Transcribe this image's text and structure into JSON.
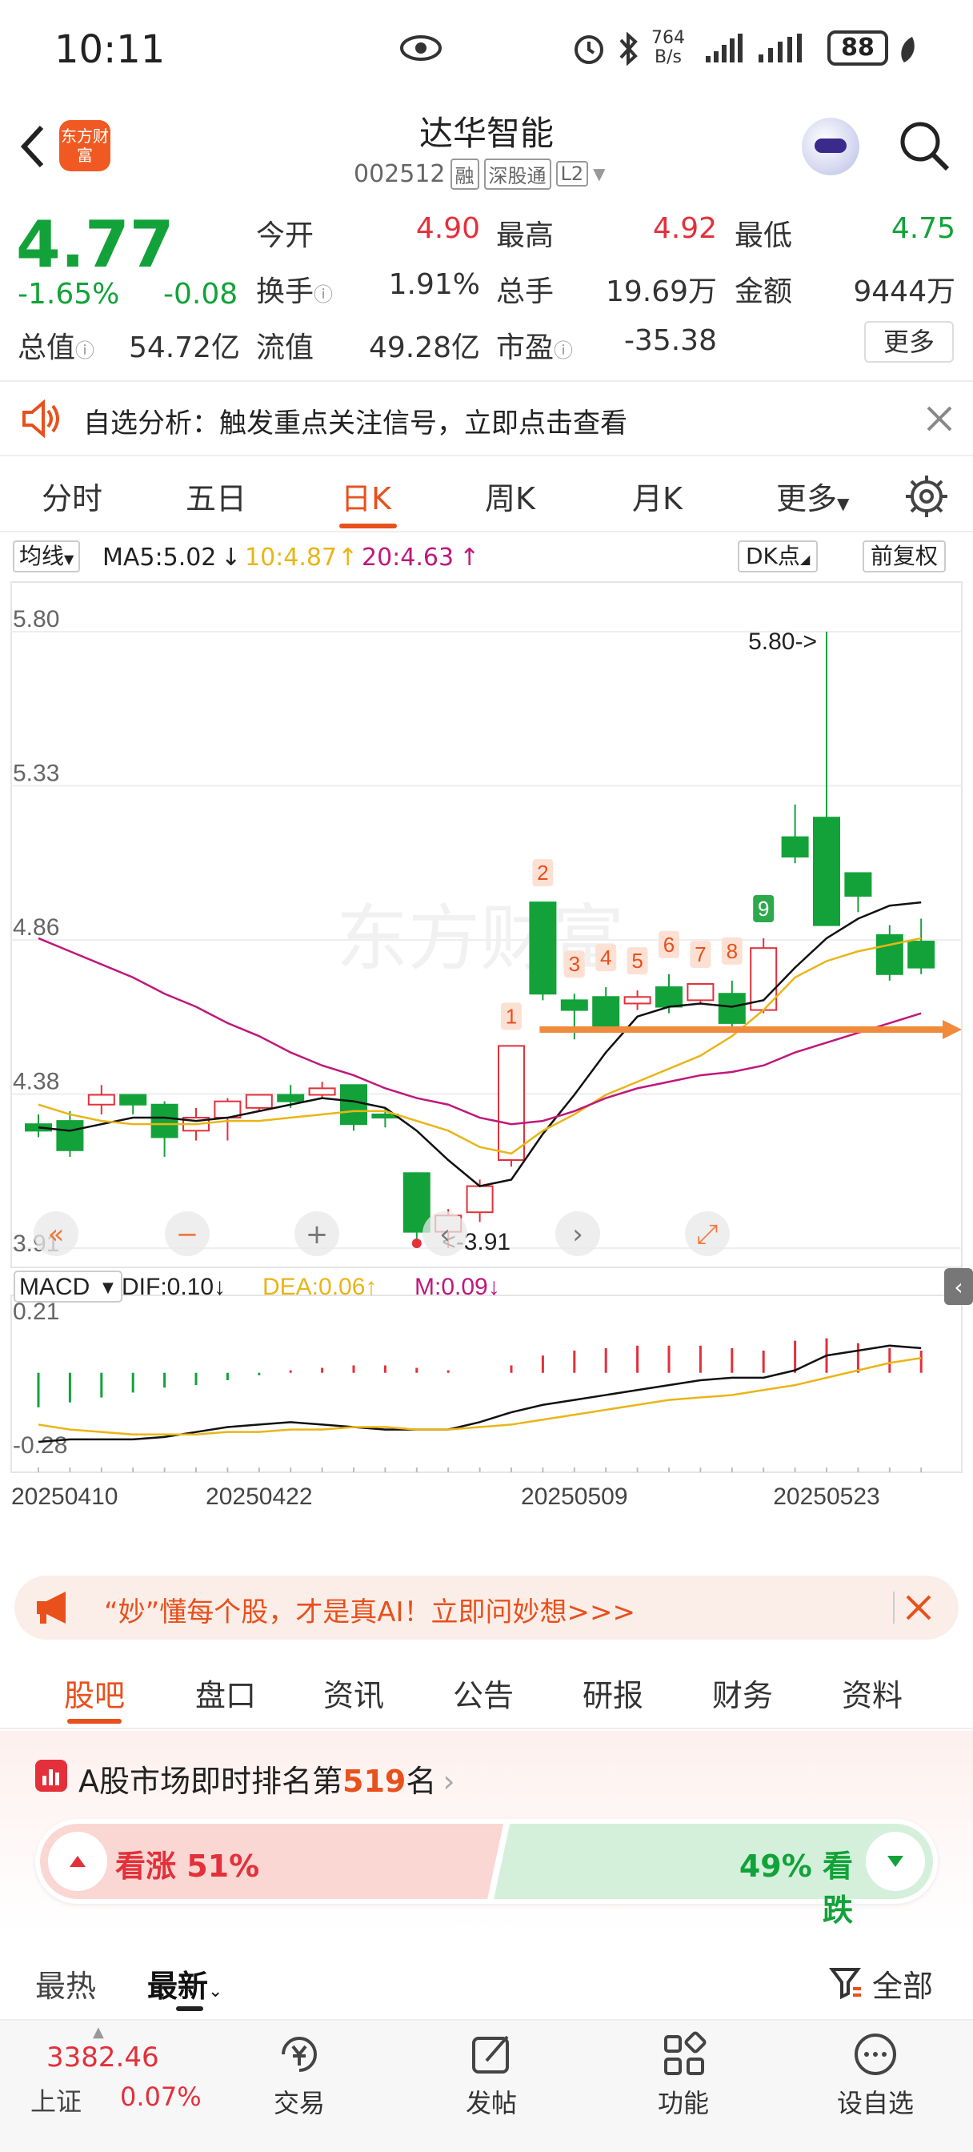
{
  "status": {
    "time": "10:11",
    "net_speed_value": "764",
    "net_speed_unit": "B/s",
    "battery": "88"
  },
  "header": {
    "title": "达华智能",
    "code": "002512",
    "tags": [
      "融",
      "深股通",
      "L2"
    ],
    "logo_text": "东方财富"
  },
  "quote": {
    "price": "4.77",
    "change_pct": "-1.65%",
    "change": "-0.08",
    "stats": [
      {
        "label": "今开",
        "value": "4.90",
        "color": "red"
      },
      {
        "label": "最高",
        "value": "4.92",
        "color": "red"
      },
      {
        "label": "最低",
        "value": "4.75",
        "color": "green"
      },
      {
        "label": "换手",
        "value": "1.91%",
        "color": "dark"
      },
      {
        "label": "总手",
        "value": "19.69万",
        "color": "dark"
      },
      {
        "label": "金额",
        "value": "9444万",
        "color": "dark"
      },
      {
        "label": "总值",
        "value": "54.72亿",
        "color": "dark"
      },
      {
        "label": "流值",
        "value": "49.28亿",
        "color": "dark"
      },
      {
        "label": "市盈",
        "value": "-35.38",
        "color": "dark"
      }
    ],
    "more_button": "更多"
  },
  "banner": {
    "text": "自选分析：触发重点关注信号，立即点击查看"
  },
  "chart_tabs": [
    "分时",
    "五日",
    "日K",
    "周K",
    "月K",
    "更多"
  ],
  "chart_header": {
    "ma_type": "均线",
    "ma5": "MA5:5.02",
    "ma10": "10:4.87",
    "ma20": "20:4.63",
    "dk": "DK点",
    "adjust": "前复权"
  },
  "chart_data": [
    {
      "type": "candlestick",
      "title": "",
      "y_ticks": [
        "5.80",
        "5.33",
        "4.86",
        "4.38",
        "3.91"
      ],
      "ylim": [
        3.91,
        5.8
      ],
      "annotations": {
        "high": "5.80->",
        "low": "<-3.91"
      },
      "candles": [
        {
          "o": 4.29,
          "c": 4.27,
          "h": 4.32,
          "l": 4.25
        },
        {
          "o": 4.3,
          "c": 4.21,
          "h": 4.33,
          "l": 4.19
        },
        {
          "o": 4.35,
          "c": 4.38,
          "h": 4.41,
          "l": 4.32
        },
        {
          "o": 4.38,
          "c": 4.35,
          "h": 4.38,
          "l": 4.32
        },
        {
          "o": 4.35,
          "c": 4.25,
          "h": 4.36,
          "l": 4.19
        },
        {
          "o": 4.27,
          "c": 4.31,
          "h": 4.34,
          "l": 4.24
        },
        {
          "o": 4.31,
          "c": 4.36,
          "h": 4.37,
          "l": 4.24
        },
        {
          "o": 4.34,
          "c": 4.38,
          "h": 4.38,
          "l": 4.33
        },
        {
          "o": 4.38,
          "c": 4.36,
          "h": 4.41,
          "l": 4.34
        },
        {
          "o": 4.38,
          "c": 4.4,
          "h": 4.42,
          "l": 4.37
        },
        {
          "o": 4.41,
          "c": 4.29,
          "h": 4.41,
          "l": 4.27
        },
        {
          "o": 4.32,
          "c": 4.31,
          "h": 4.34,
          "l": 4.28
        },
        {
          "o": 4.14,
          "c": 3.96,
          "h": 4.14,
          "l": 3.91
        },
        {
          "o": 3.96,
          "c": 4.01,
          "h": 4.03,
          "l": 3.91
        },
        {
          "o": 4.02,
          "c": 4.1,
          "h": 4.12,
          "l": 3.99
        },
        {
          "o": 4.18,
          "c": 4.53,
          "h": 4.53,
          "l": 4.16
        },
        {
          "o": 4.97,
          "c": 4.69,
          "h": 4.97,
          "l": 4.67
        },
        {
          "o": 4.67,
          "c": 4.64,
          "h": 4.69,
          "l": 4.55
        },
        {
          "o": 4.68,
          "c": 4.58,
          "h": 4.71,
          "l": 4.57
        },
        {
          "o": 4.66,
          "c": 4.68,
          "h": 4.7,
          "l": 4.64
        },
        {
          "o": 4.71,
          "c": 4.65,
          "h": 4.75,
          "l": 4.63
        },
        {
          "o": 4.67,
          "c": 4.72,
          "h": 4.72,
          "l": 4.66
        },
        {
          "o": 4.69,
          "c": 4.6,
          "h": 4.73,
          "l": 4.59
        },
        {
          "o": 4.64,
          "c": 4.83,
          "h": 4.86,
          "l": 4.63
        },
        {
          "o": 5.17,
          "c": 5.11,
          "h": 5.27,
          "l": 5.09
        },
        {
          "o": 5.23,
          "c": 4.9,
          "h": 5.8,
          "l": 4.9
        },
        {
          "o": 5.06,
          "c": 4.99,
          "h": 5.05,
          "l": 4.94
        },
        {
          "o": 4.87,
          "c": 4.75,
          "h": 4.9,
          "l": 4.73
        },
        {
          "o": 4.85,
          "c": 4.77,
          "h": 4.92,
          "l": 4.75
        }
      ],
      "ma_lines": [
        {
          "name": "MA5",
          "color": "#111111",
          "values": [
            4.28,
            4.27,
            4.29,
            4.31,
            4.31,
            4.3,
            4.31,
            4.33,
            4.35,
            4.37,
            4.36,
            4.34,
            4.27,
            4.18,
            4.1,
            4.12,
            4.26,
            4.38,
            4.51,
            4.62,
            4.65,
            4.66,
            4.65,
            4.67,
            4.77,
            4.86,
            4.92,
            4.96,
            4.97
          ]
        },
        {
          "name": "MA10",
          "color": "#e9b517",
          "values": [
            4.35,
            4.32,
            4.3,
            4.29,
            4.29,
            4.29,
            4.3,
            4.3,
            4.31,
            4.32,
            4.33,
            4.33,
            4.3,
            4.27,
            4.22,
            4.2,
            4.27,
            4.32,
            4.38,
            4.42,
            4.46,
            4.5,
            4.56,
            4.64,
            4.74,
            4.79,
            4.82,
            4.84,
            4.86
          ]
        },
        {
          "name": "MA20",
          "color": "#c0187b",
          "values": [
            4.86,
            4.82,
            4.78,
            4.74,
            4.69,
            4.65,
            4.6,
            4.56,
            4.51,
            4.47,
            4.44,
            4.4,
            4.37,
            4.35,
            4.31,
            4.29,
            4.3,
            4.33,
            4.37,
            4.4,
            4.42,
            4.44,
            4.45,
            4.47,
            4.51,
            4.54,
            4.57,
            4.6,
            4.63
          ]
        }
      ],
      "marker_labels": [
        "1",
        "2",
        "3",
        "4",
        "5",
        "6",
        "7",
        "8",
        "9"
      ]
    },
    {
      "type": "bar",
      "title": "",
      "name": "MACD",
      "legend": {
        "dif": "DIF:0.10",
        "dea": "DEA:0.06",
        "m": "M:0.09"
      },
      "y_ticks": [
        "0.21",
        "-0.28"
      ],
      "ylim": [
        -0.28,
        0.21
      ],
      "x_tick_labels": [
        "20250410",
        "20250422",
        "20250509",
        "20250523"
      ],
      "hist": [
        -0.14,
        -0.12,
        -0.1,
        -0.08,
        -0.06,
        -0.05,
        -0.03,
        -0.01,
        0.01,
        0.02,
        0.03,
        0.03,
        0.02,
        0.01,
        0.0,
        0.03,
        0.07,
        0.09,
        0.1,
        0.11,
        0.11,
        0.11,
        0.1,
        0.09,
        0.13,
        0.14,
        0.12,
        0.1,
        0.09
      ],
      "dif": [
        -0.28,
        -0.27,
        -0.27,
        -0.27,
        -0.26,
        -0.24,
        -0.22,
        -0.21,
        -0.2,
        -0.21,
        -0.22,
        -0.23,
        -0.23,
        -0.23,
        -0.2,
        -0.16,
        -0.13,
        -0.11,
        -0.09,
        -0.07,
        -0.05,
        -0.03,
        -0.02,
        -0.02,
        0.01,
        0.07,
        0.09,
        0.11,
        0.1
      ],
      "dea": [
        -0.21,
        -0.23,
        -0.24,
        -0.25,
        -0.25,
        -0.25,
        -0.24,
        -0.24,
        -0.23,
        -0.23,
        -0.22,
        -0.22,
        -0.23,
        -0.23,
        -0.22,
        -0.21,
        -0.19,
        -0.17,
        -0.15,
        -0.13,
        -0.11,
        -0.1,
        -0.09,
        -0.07,
        -0.05,
        -0.02,
        0.01,
        0.04,
        0.06
      ]
    }
  ],
  "ad": {
    "text": "“妙”懂每个股，才是真AI！立即问妙想>>>"
  },
  "sub_tabs": [
    "股吧",
    "盘口",
    "资讯",
    "公告",
    "研报",
    "财务",
    "资料"
  ],
  "rank": {
    "prefix": "A股市场即时排名第",
    "number": "519",
    "suffix": "名",
    "bull": "看涨 51%",
    "bear": "49% 看跌",
    "bull_ratio": 0.51
  },
  "feed_tabs": {
    "hot": "最热",
    "latest": "最新",
    "filter": "全部"
  },
  "bottom_nav": {
    "index_value": "3382.46",
    "index_name": "上证",
    "index_change": "0.07%",
    "items": [
      "交易",
      "发帖",
      "功能",
      "设自选"
    ]
  }
}
